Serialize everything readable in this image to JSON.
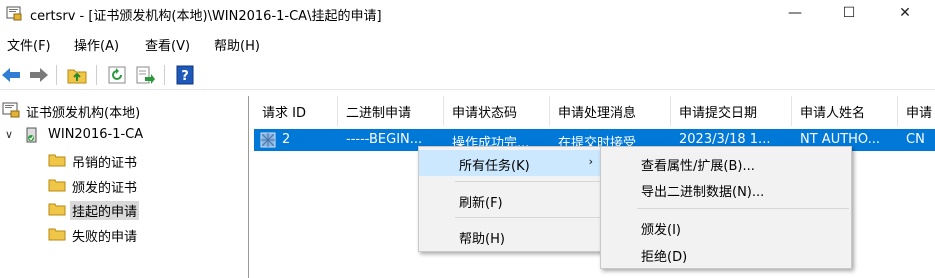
{
  "window": {
    "title": "certsrv - [证书颁发机构(本地)\\WIN2016-1-CA\\挂起的申请]",
    "min_glyph": "—",
    "max_glyph": "☐",
    "close_glyph": "✕"
  },
  "menu": [
    "文件(F)",
    "操作(A)",
    "查看(V)",
    "帮助(H)"
  ],
  "toolbar_icons": [
    "back-icon",
    "forward-icon",
    "up-folder-icon",
    "refresh-icon",
    "export-list-icon",
    "help-icon"
  ],
  "tree": {
    "root": "证书颁发机构(本地)",
    "ca": "WIN2016-1-CA",
    "ca_expander": "∨",
    "children": [
      "吊销的证书",
      "颁发的证书",
      "挂起的申请",
      "失败的申请"
    ],
    "selected_index": 2
  },
  "list": {
    "columns": [
      "请求 ID",
      "二进制申请",
      "申请状态码",
      "申请处理消息",
      "申请提交日期",
      "申请人姓名",
      "申请"
    ],
    "rows": [
      [
        "2",
        "-----BEGIN...",
        "操作成功完...",
        "在提交时接受",
        "2023/3/18 1...",
        "NT AUTHO...",
        "CN"
      ]
    ]
  },
  "context_menu": {
    "items": [
      "所有任务(K)",
      "刷新(F)",
      "帮助(H)"
    ],
    "submenu_arrow": "›"
  },
  "submenu": {
    "items": [
      "查看属性/扩展(B)...",
      "导出二进制数据(N)...",
      "颁发(I)",
      "拒绝(D)"
    ]
  },
  "colors": {
    "selection": "#0078d7",
    "menu_highlight": "#cce8ff",
    "folder": "#f0c648"
  }
}
